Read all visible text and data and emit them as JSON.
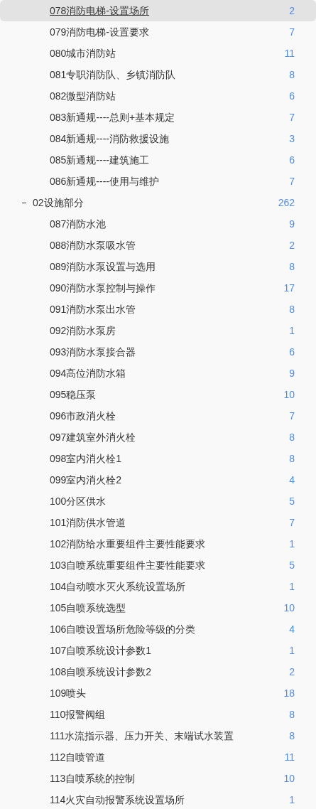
{
  "tree": [
    {
      "label": "078消防电梯-设置场所",
      "count": "2",
      "selected": true
    },
    {
      "label": "079消防电梯-设置要求",
      "count": "7",
      "selected": false
    },
    {
      "label": "080城市消防站",
      "count": "11",
      "selected": false
    },
    {
      "label": "081专职消防队、乡镇消防队",
      "count": "8",
      "selected": false
    },
    {
      "label": "082微型消防站",
      "count": "6",
      "selected": false
    },
    {
      "label": "083新通规----总则+基本规定",
      "count": "7",
      "selected": false
    },
    {
      "label": "084新通规----消防救援设施",
      "count": "3",
      "selected": false
    },
    {
      "label": "085新通规----建筑施工",
      "count": "6",
      "selected": false
    },
    {
      "label": "086新通规----使用与维护",
      "count": "7",
      "selected": false
    },
    {
      "label": "02设施部分",
      "count": "262",
      "selected": false,
      "expanded": true,
      "children": [
        {
          "label": "087消防水池",
          "count": "9",
          "selected": false
        },
        {
          "label": "088消防水泵吸水管",
          "count": "2",
          "selected": false
        },
        {
          "label": "089消防水泵设置与选用",
          "count": "8",
          "selected": false
        },
        {
          "label": "090消防水泵控制与操作",
          "count": "17",
          "selected": false
        },
        {
          "label": "091消防水泵出水管",
          "count": "8",
          "selected": false
        },
        {
          "label": "092消防水泵房",
          "count": "1",
          "selected": false
        },
        {
          "label": "093消防水泵接合器",
          "count": "6",
          "selected": false
        },
        {
          "label": "094高位消防水箱",
          "count": "9",
          "selected": false
        },
        {
          "label": "095稳压泵",
          "count": "10",
          "selected": false
        },
        {
          "label": "096市政消火栓",
          "count": "7",
          "selected": false
        },
        {
          "label": "097建筑室外消火栓",
          "count": "8",
          "selected": false
        },
        {
          "label": "098室内消火栓1",
          "count": "8",
          "selected": false
        },
        {
          "label": "099室内消火栓2",
          "count": "4",
          "selected": false
        },
        {
          "label": "100分区供水",
          "count": "5",
          "selected": false
        },
        {
          "label": "101消防供水管道",
          "count": "7",
          "selected": false
        },
        {
          "label": "102消防给水重要组件主要性能要求",
          "count": "1",
          "selected": false
        },
        {
          "label": "103自喷系统重要组件主要性能要求",
          "count": "5",
          "selected": false
        },
        {
          "label": "104自动喷水灭火系统设置场所",
          "count": "1",
          "selected": false
        },
        {
          "label": "105自喷系统选型",
          "count": "10",
          "selected": false
        },
        {
          "label": "106自喷设置场所危险等级的分类",
          "count": "4",
          "selected": false
        },
        {
          "label": "107自喷系统设计参数1",
          "count": "1",
          "selected": false
        },
        {
          "label": "108自喷系统设计参数2",
          "count": "2",
          "selected": false
        },
        {
          "label": "109喷头",
          "count": "18",
          "selected": false
        },
        {
          "label": "110报警阀组",
          "count": "8",
          "selected": false
        },
        {
          "label": "111水流指示器、压力开关、末端试水装置",
          "count": "8",
          "selected": false
        },
        {
          "label": "112自喷管道",
          "count": "11",
          "selected": false
        },
        {
          "label": "113自喷系统的控制",
          "count": "10",
          "selected": false
        },
        {
          "label": "114火灾自动报警系统设置场所",
          "count": "1",
          "selected": false
        }
      ]
    }
  ]
}
